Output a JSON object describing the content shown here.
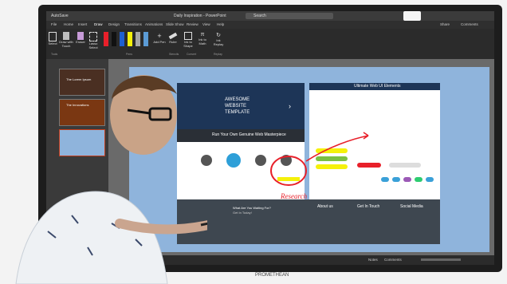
{
  "titlebar": {
    "autosave": "AutoSave",
    "doc_title": "Daily Inspiration - PowerPoint",
    "search": "Search",
    "share": "Share",
    "comments": "Comments"
  },
  "ribbon_tabs": [
    "File",
    "Home",
    "Insert",
    "Draw",
    "Design",
    "Transitions",
    "Animations",
    "Slide Show",
    "Review",
    "View",
    "Help"
  ],
  "ribbon_groups": [
    "Tools",
    "Pens",
    "Stencils",
    "Convert",
    "Replay"
  ],
  "ribbon_tools": [
    "Select",
    "Draw with Touch",
    "Eraser",
    "Lasso Select",
    "Add Pen",
    "Ruler",
    "Ink to Shape",
    "Ink to Math",
    "Ink Replay"
  ],
  "slide": {
    "hero_line1": "AWESOME",
    "hero_line2": "WEBSITE",
    "hero_line3": "TEMPLATE",
    "tagline": "Run Your Own Genuine Web Masterpiece",
    "ui_title": "Ultimate Web UI Elements",
    "annotation": "Research",
    "footer_q": "What Are You Waiting For?",
    "footer_cta": "Get In Today!",
    "footer_about": "About us",
    "footer_touch": "Get In Touch",
    "footer_social": "Social Media"
  },
  "thumbs": [
    "The Lorem Ipsum",
    "The Innovations",
    ""
  ],
  "status": {
    "notes": "Notes",
    "comments": "Comments"
  },
  "brand": "PROMETHEAN",
  "colors": {
    "ribbon_active": "#c43e1c",
    "annotation": "#e8202a",
    "highlight": "#f5f10a",
    "slide_bg": "#8fb4dc"
  }
}
